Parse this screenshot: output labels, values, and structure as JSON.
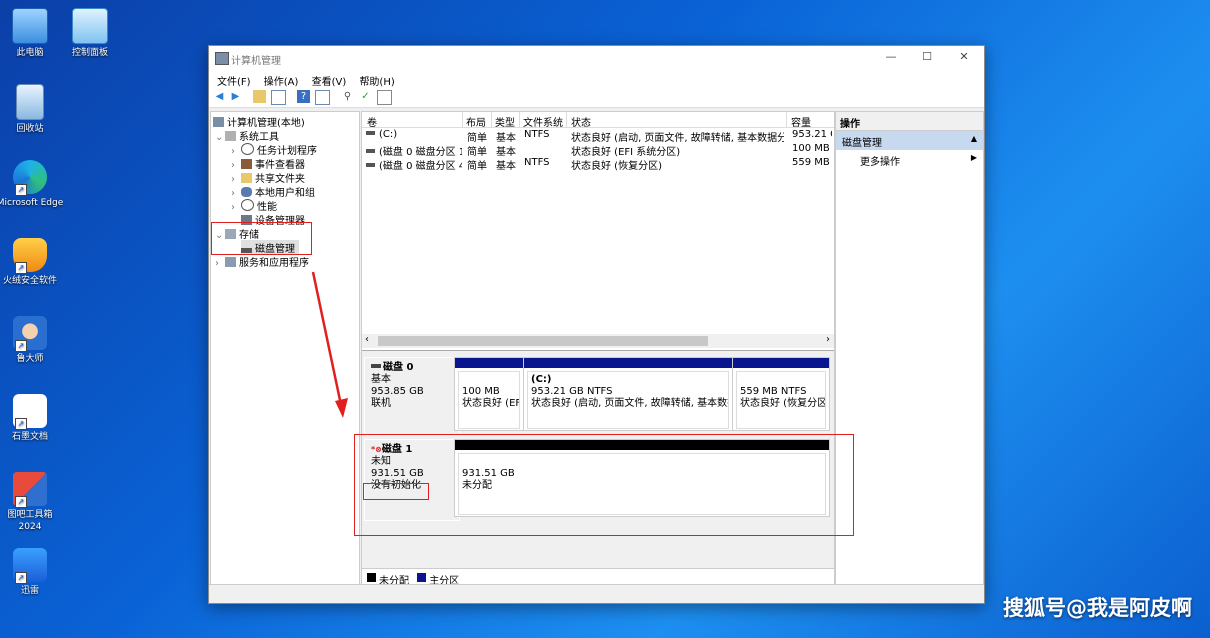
{
  "desktop": {
    "icons": [
      {
        "label": "此电脑",
        "icon": "computer-icon"
      },
      {
        "label": "控制面板",
        "icon": "control-panel-icon"
      },
      {
        "label": "回收站",
        "icon": "recycle-bin-icon"
      },
      {
        "label": "Microsoft Edge",
        "icon": "edge-icon"
      },
      {
        "label": "火绒安全软件",
        "icon": "huorong-icon"
      },
      {
        "label": "鲁大师",
        "icon": "ludashi-icon"
      },
      {
        "label": "石墨文档",
        "icon": "shimo-icon"
      },
      {
        "label": "图吧工具箱 2024",
        "icon": "tuba-toolbox-icon"
      },
      {
        "label": "迅雷",
        "icon": "xunlei-icon"
      }
    ],
    "watermark": "搜狐号@我是阿皮啊"
  },
  "window": {
    "title": "计算机管理",
    "controls": {
      "minimize": "—",
      "maximize": "☐",
      "close": "✕"
    },
    "menu": [
      "文件(F)",
      "操作(A)",
      "查看(V)",
      "帮助(H)"
    ]
  },
  "tree": {
    "root": "计算机管理(本地)",
    "system_tools": "系统工具",
    "task_scheduler": "任务计划程序",
    "event_viewer": "事件查看器",
    "shared_folders": "共享文件夹",
    "local_users": "本地用户和组",
    "performance": "性能",
    "device_manager": "设备管理器",
    "storage": "存储",
    "disk_management": "磁盘管理",
    "services_apps": "服务和应用程序"
  },
  "volumes": {
    "columns": [
      "卷",
      "布局",
      "类型",
      "文件系统",
      "状态",
      "容量"
    ],
    "rows": [
      {
        "name": "(C:)",
        "layout": "简单",
        "type": "基本",
        "fs": "NTFS",
        "status": "状态良好 (启动, 页面文件, 故障转储, 基本数据分区)",
        "capacity": "953.21 G"
      },
      {
        "name": "(磁盘 0 磁盘分区 1)",
        "layout": "简单",
        "type": "基本",
        "fs": "",
        "status": "状态良好 (EFI 系统分区)",
        "capacity": "100 MB"
      },
      {
        "name": "(磁盘 0 磁盘分区 4)",
        "layout": "简单",
        "type": "基本",
        "fs": "NTFS",
        "status": "状态良好 (恢复分区)",
        "capacity": "559 MB"
      }
    ],
    "scroll_left": "‹",
    "scroll_right": "›"
  },
  "disks": {
    "disk0": {
      "name": "磁盘 0",
      "type": "基本",
      "size": "953.85 GB",
      "state": "联机",
      "partitions": [
        {
          "size": "100 MB",
          "status": "状态良好 (EFI"
        },
        {
          "label": "(C:)",
          "size": "953.21 GB NTFS",
          "status": "状态良好 (启动, 页面文件, 故障转储, 基本数据分"
        },
        {
          "size": "559 MB NTFS",
          "status": "状态良好 (恢复分区)"
        }
      ]
    },
    "disk1": {
      "name": "磁盘 1",
      "type": "未知",
      "size": "931.51 GB",
      "state": "没有初始化",
      "partition": {
        "size": "931.51 GB",
        "status": "未分配"
      }
    }
  },
  "legend": {
    "unallocated": "未分配",
    "primary": "主分区",
    "unallocated_color": "#000000",
    "primary_color": "#0a1590"
  },
  "actions": {
    "header": "操作",
    "section": "磁盘管理",
    "section_arrow": "▲",
    "more": "更多操作",
    "more_arrow": "▶"
  }
}
